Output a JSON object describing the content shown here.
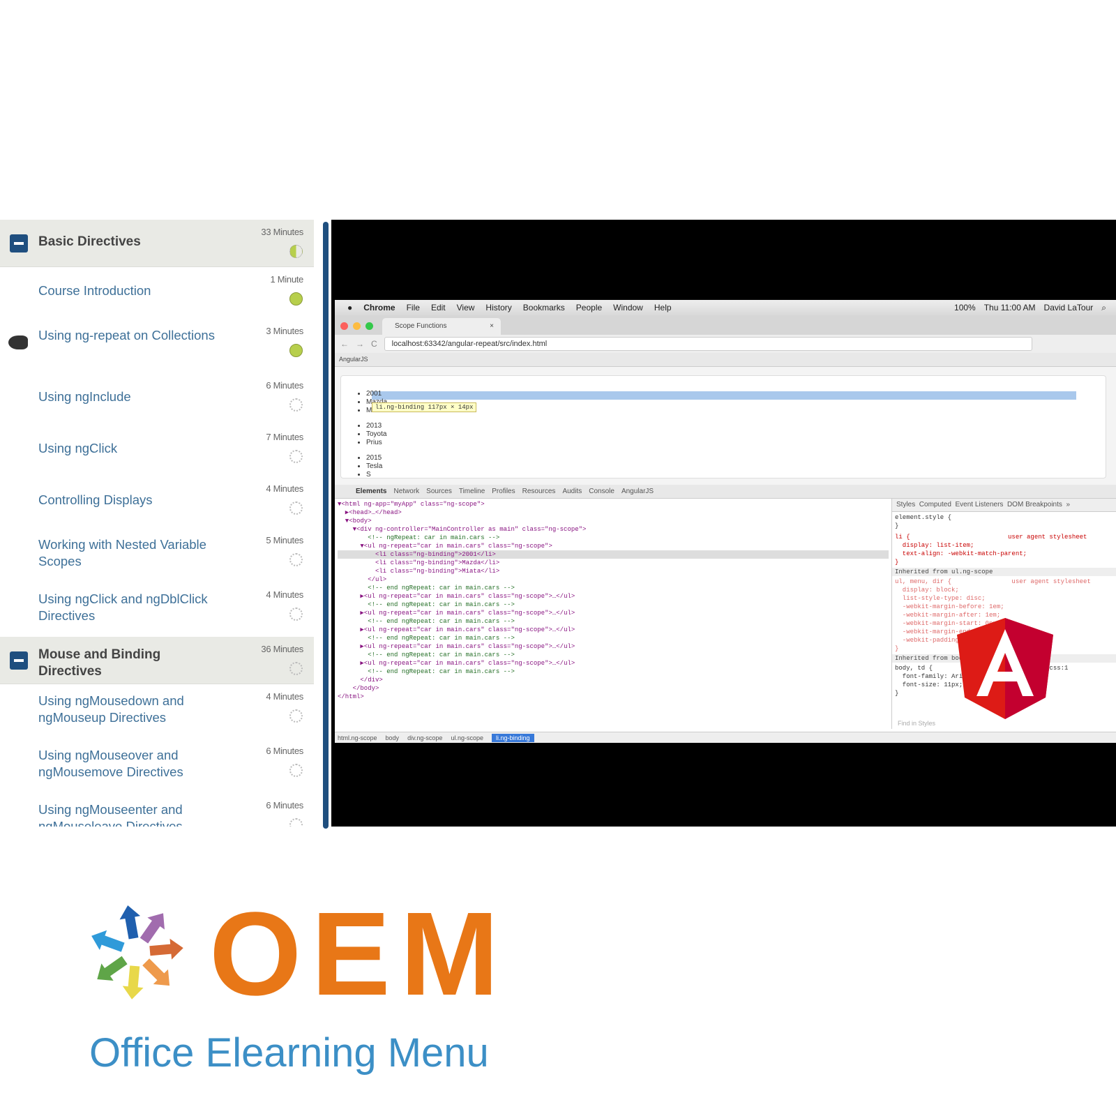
{
  "sidebar": {
    "sections": [
      {
        "title": "Basic Directives",
        "duration": "33 Minutes",
        "status": "partial",
        "items": [
          {
            "title": "Course Introduction",
            "duration": "1 Minute",
            "status": "complete"
          },
          {
            "title": "Using ng-repeat on Collections",
            "duration": "3 Minutes",
            "status": "complete",
            "current": true
          },
          {
            "title": "Using ngInclude",
            "duration": "6 Minutes",
            "status": "not-started"
          },
          {
            "title": "Using ngClick",
            "duration": "7 Minutes",
            "status": "not-started"
          },
          {
            "title": "Controlling Displays",
            "duration": "4 Minutes",
            "status": "not-started"
          },
          {
            "title": "Working with Nested Variable Scopes",
            "duration": "5 Minutes",
            "status": "not-started"
          },
          {
            "title": "Using ngClick and ngDblClick Directives",
            "duration": "4 Minutes",
            "status": "not-started"
          }
        ]
      },
      {
        "title": "Mouse and Binding Directives",
        "duration": "36 Minutes",
        "status": "not-started",
        "items": [
          {
            "title": "Using ngMousedown and ngMouseup Directives",
            "duration": "4 Minutes",
            "status": "not-started"
          },
          {
            "title": "Using ngMouseover and ngMousemove Directives",
            "duration": "6 Minutes",
            "status": "not-started"
          },
          {
            "title": "Using ngMouseenter and ngMouseleave Directives",
            "duration": "6 Minutes",
            "status": "not-started"
          }
        ]
      }
    ]
  },
  "video": {
    "menubar": {
      "items": [
        "Chrome",
        "File",
        "Edit",
        "View",
        "History",
        "Bookmarks",
        "People",
        "Window",
        "Help"
      ],
      "battery": "100%",
      "clock": "Thu 11:00 AM",
      "user": "David LaTour"
    },
    "tab_title": "Scope Functions",
    "url": "localhost:63342/angular-repeat/src/index.html",
    "bookmark": "AngularJS",
    "page_list": [
      "2001",
      "Mazda",
      "Miata",
      "2013",
      "Toyota",
      "Prius",
      "2015",
      "Tesla",
      "S"
    ],
    "tooltip": "li.ng-binding 117px × 14px",
    "devtools_tabs": [
      "Elements",
      "Network",
      "Sources",
      "Timeline",
      "Profiles",
      "Resources",
      "Audits",
      "Console",
      "AngularJS"
    ],
    "elements": [
      "▼<html ng-app=\"myApp\" class=\"ng-scope\">",
      "  ▶<head>…</head>",
      "  ▼<body>",
      "    ▼<div ng-controller=\"MainController as main\" class=\"ng-scope\">",
      "        <!-- ngRepeat: car in main.cars -->",
      "      ▼<ul ng-repeat=\"car in main.cars\" class=\"ng-scope\">",
      "          <li class=\"ng-binding\">2001</li>",
      "          <li class=\"ng-binding\">Mazda</li>",
      "          <li class=\"ng-binding\">Miata</li>",
      "        </ul>",
      "        <!-- end ngRepeat: car in main.cars -->",
      "      ▶<ul ng-repeat=\"car in main.cars\" class=\"ng-scope\">…</ul>",
      "        <!-- end ngRepeat: car in main.cars -->",
      "      ▶<ul ng-repeat=\"car in main.cars\" class=\"ng-scope\">…</ul>",
      "        <!-- end ngRepeat: car in main.cars -->",
      "      ▶<ul ng-repeat=\"car in main.cars\" class=\"ng-scope\">…</ul>",
      "        <!-- end ngRepeat: car in main.cars -->",
      "      ▶<ul ng-repeat=\"car in main.cars\" class=\"ng-scope\">…</ul>",
      "        <!-- end ngRepeat: car in main.cars -->",
      "      ▶<ul ng-repeat=\"car in main.cars\" class=\"ng-scope\">…</ul>",
      "        <!-- end ngRepeat: car in main.cars -->",
      "      </div>",
      "    </body>",
      "</html>"
    ],
    "styles_tabs": "Styles  Computed  Event Listeners  DOM Breakpoints  »",
    "styles": {
      "element_style": "element.style {\n}",
      "li_rule": "li {                          user agent stylesheet\n  display: list-item;\n  text-align: -webkit-match-parent;\n}",
      "inherited1": "Inherited from ul.ng-scope",
      "ul_rule": "ul, menu, dir {                user agent stylesheet\n  display: block;\n  list-style-type: disc;\n  -webkit-margin-before: 1em;\n  -webkit-margin-after: 1em;\n  -webkit-margin-start: 0px;\n  -webkit-margin-end: 0px;\n  -webkit-padding-start: 40px;\n}",
      "inherited2": "Inherited from body",
      "body_rule": "body, td {                          main.css:1\n  font-family: Arial, sans-serif;\n  font-size: 11px;\n}",
      "find": "Find in Styles"
    },
    "breadcrumbs": [
      "html.ng-scope",
      "body",
      "div.ng-scope",
      "ul.ng-scope",
      "li.ng-binding"
    ]
  },
  "logo": {
    "wordmark": "OEM",
    "tagline": "Office Elearning Menu"
  },
  "colors": {
    "accent": "#1f4f7f",
    "complete": "#b7cf4c",
    "link": "#3e7098",
    "brand_orange": "#e87717",
    "brand_blue": "#3c8fc6",
    "angular_red": "#dd1b16"
  }
}
